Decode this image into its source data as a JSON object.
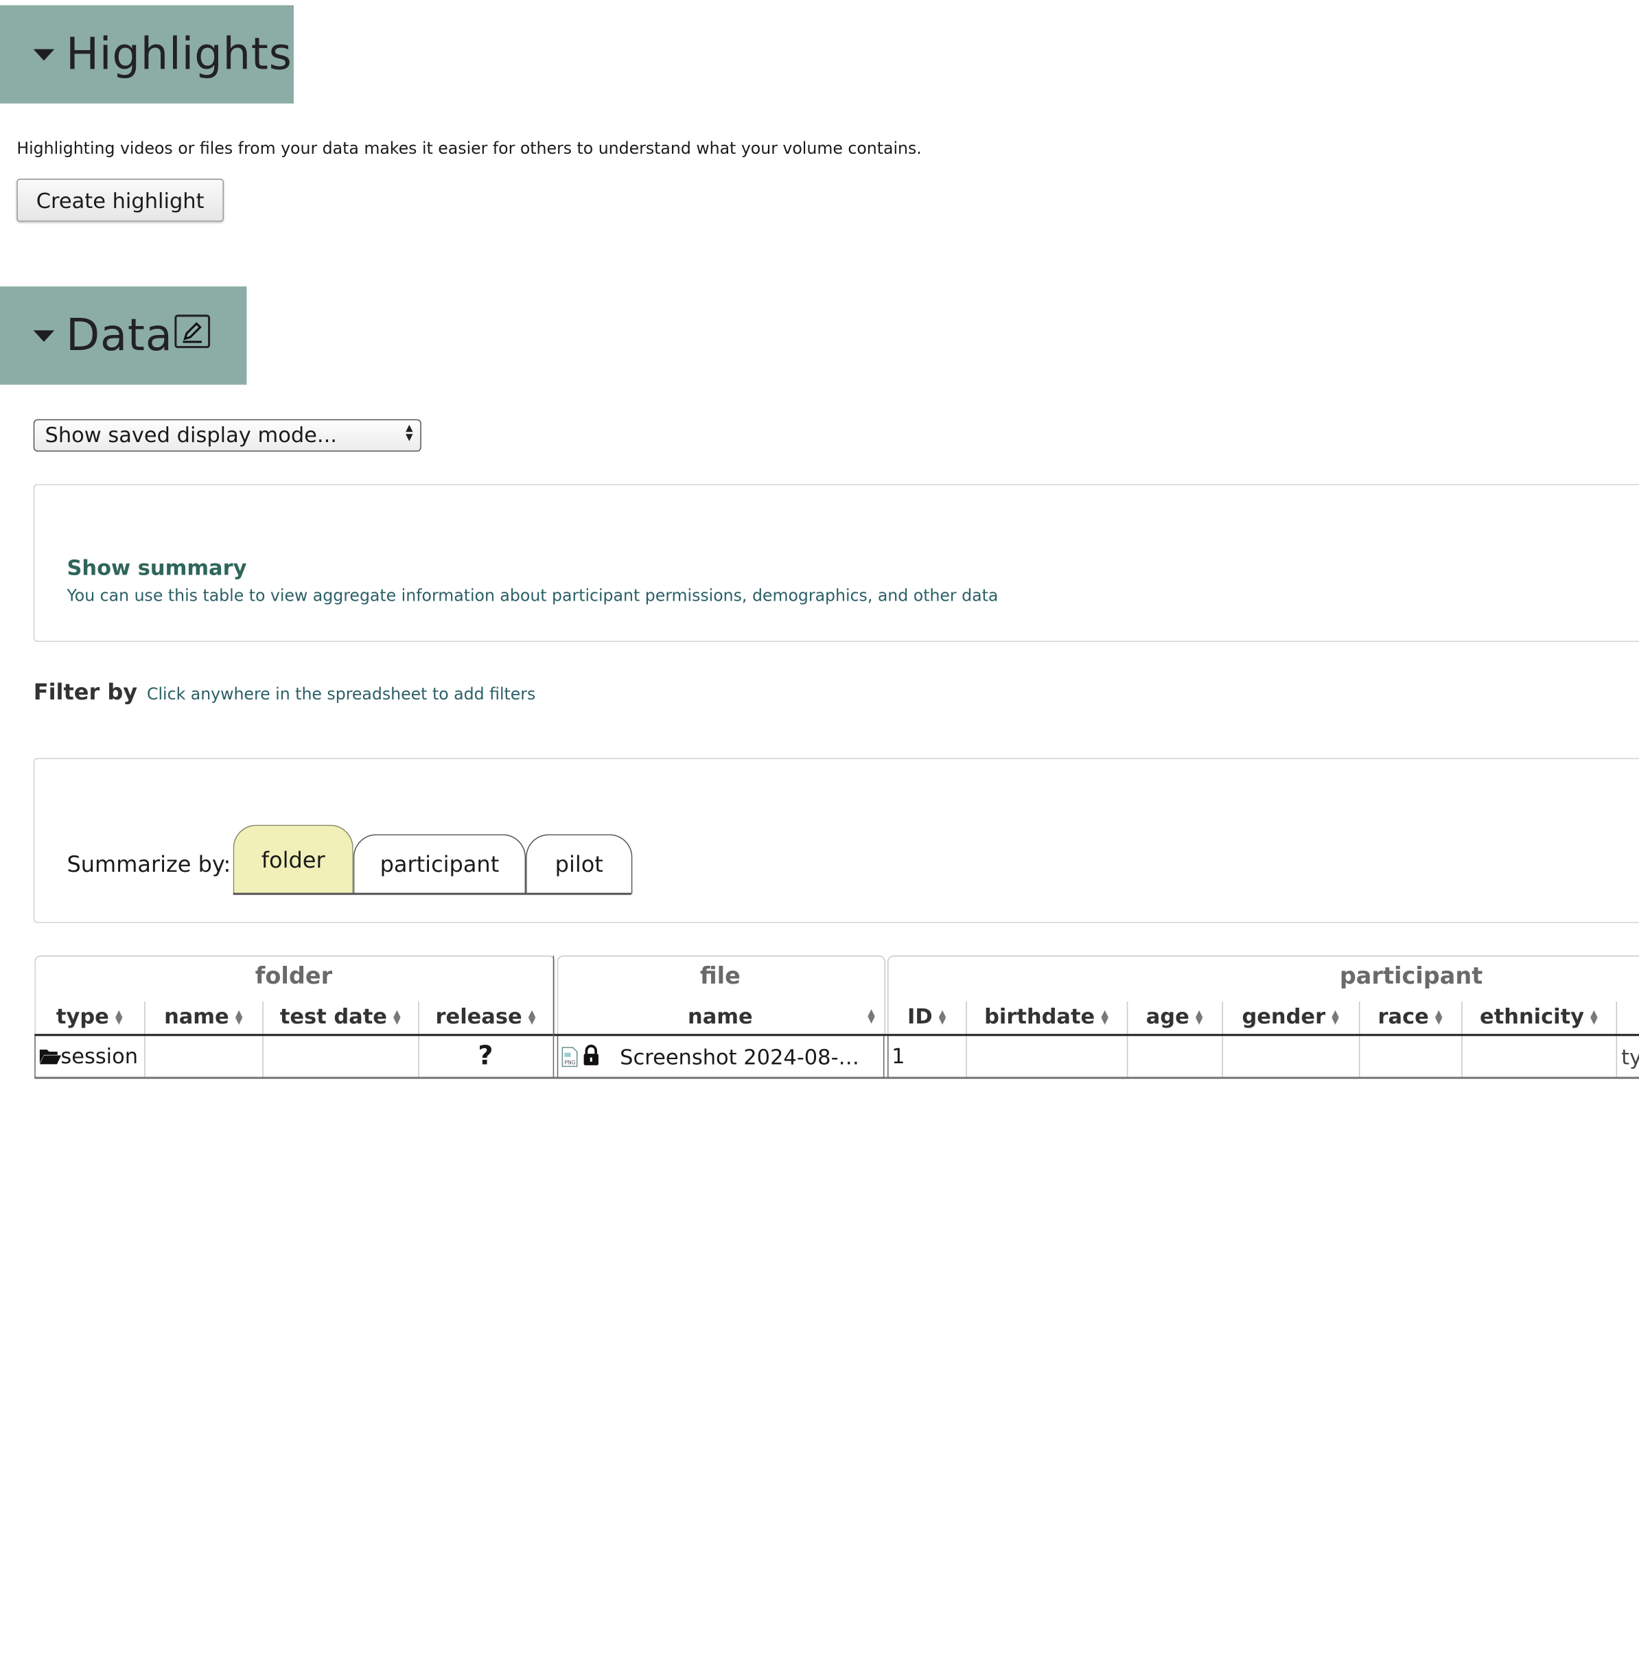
{
  "highlights": {
    "title": "Highlights",
    "description": "Highlighting videos or files from your data makes it easier for others to understand what your volume contains.",
    "create_button": "Create highlight"
  },
  "data_section": {
    "title": "Data",
    "display_mode_select": "Show saved display mode..."
  },
  "summary": {
    "heading": "Show summary",
    "text": "You can use this table to view aggregate information about participant permissions, demographics, and other data"
  },
  "filter": {
    "label": "Filter by",
    "hint": "Click anywhere in the spreadsheet to add filters"
  },
  "summarize": {
    "label": "Summarize by:",
    "tabs": [
      "folder",
      "participant",
      "pilot"
    ],
    "active": "folder"
  },
  "table": {
    "groups": [
      "folder",
      "file",
      "participant"
    ],
    "columns": [
      "type",
      "name",
      "test date",
      "release",
      "name",
      "ID",
      "birthdate",
      "age",
      "gender",
      "race",
      "ethnicity"
    ],
    "row": {
      "type": "session",
      "release": "?",
      "file_name": "Screenshot 2024-08-…",
      "id": "1",
      "overflow": "ty"
    }
  }
}
